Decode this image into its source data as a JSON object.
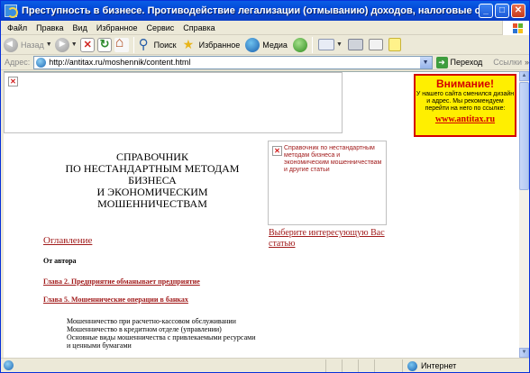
{
  "window": {
    "title": "Преступность в бизнесе. Противодействие легализации (отмыванию) доходов, налоговые схемы, офшор - Microsoft Inte...",
    "minimize": "_",
    "maximize": "□",
    "close": "✕"
  },
  "menu": [
    "Файл",
    "Правка",
    "Вид",
    "Избранное",
    "Сервис",
    "Справка"
  ],
  "toolbar": {
    "back": "Назад",
    "search": "Поиск",
    "favorites": "Избранное",
    "media": "Медиа"
  },
  "address": {
    "label": "Адрес:",
    "url": "http://antitax.ru/moshennik/content.html",
    "go": "Переход",
    "links": "Ссылки"
  },
  "page": {
    "warning": {
      "title": "Внимание!",
      "text": "У нашего сайта сменился дизайн и адрес. Мы рекомендуем перейти на него по ссылке:",
      "link": "www.antitax.ru"
    },
    "heading": [
      "СПРАВОЧНИК",
      "ПО НЕСТАНДАРТНЫМ МЕТОДАМ",
      "БИЗНЕСА",
      "И ЭКОНОМИЧЕСКИМ",
      "МОШЕННИЧЕСТВАМ"
    ],
    "side_box_text": "Справочник по нестандартным методам бизнеса и экономическим мошенничествам и другие статьи",
    "choose_link": "Выберите интересующую Вас статью",
    "toc_link": "Оглавление",
    "author": "От автора",
    "chapter2": "Глава 2. Предприятие обманывает предприятие",
    "chapter5": "Глава 5. Мошеннические операции в банках",
    "sublist": [
      "Мошенничество при расчетно-кассовом обслуживании",
      "Мошенничество в кредитном отделе (управлении)",
      "Основные виды мошенничества с привлекаемыми ресурсами и ценными бумагами"
    ]
  },
  "status": {
    "zone": "Интернет"
  }
}
